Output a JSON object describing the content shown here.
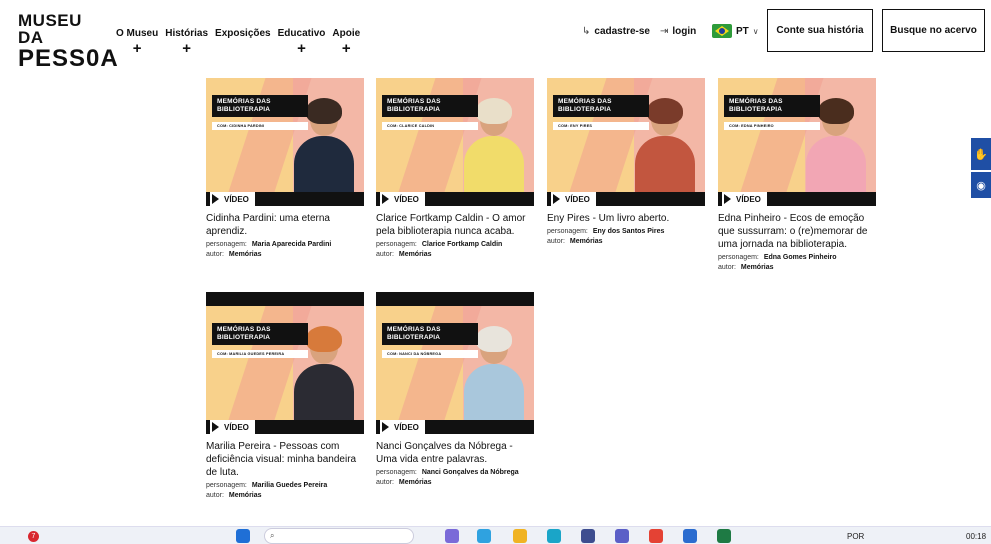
{
  "header": {
    "logo_line1": "MUSEU DA",
    "logo_line2": "PESS0A",
    "nav": [
      {
        "label": "O Museu",
        "plus": "+"
      },
      {
        "label": "Histórias",
        "plus": "+"
      },
      {
        "label": "Exposições",
        "plus": ""
      },
      {
        "label": "Educativo",
        "plus": "+"
      },
      {
        "label": "Apoie",
        "plus": "+"
      }
    ],
    "register_label": "cadastre-se",
    "login_label": "login",
    "language": "PT",
    "share_story_label": "Conte sua história",
    "search_collection_label": "Busque no acervo"
  },
  "cards": [
    {
      "tag_line1": "MEMÓRIAS DAS",
      "tag_line2": "BIBLIOTERAPIA",
      "tag_sub": "COM: CIDINHA PARDINI",
      "video_label": "VÍDEO",
      "title": "Cidinha Pardini: uma eterna aprendiz.",
      "persona_label": "personagem:",
      "persona": "Maria Aparecida Pardini",
      "author_label": "autor:",
      "author": "Memórias",
      "hair": "#3a2a22",
      "shirt": "#1f2a3d"
    },
    {
      "tag_line1": "MEMÓRIAS DAS",
      "tag_line2": "BIBLIOTERAPIA",
      "tag_sub": "COM: CLARICE CALDIN",
      "video_label": "VÍDEO",
      "title": "Clarice Fortkamp Caldin - O amor pela biblioterapia nunca acaba.",
      "persona_label": "personagem:",
      "persona": "Clarice Fortkamp Caldin",
      "author_label": "autor:",
      "author": "Memórias",
      "hair": "#e9dfc9",
      "shirt": "#f1dc6a"
    },
    {
      "tag_line1": "MEMÓRIAS DAS",
      "tag_line2": "BIBLIOTERAPIA",
      "tag_sub": "COM: ENY PIRES",
      "video_label": "VÍDEO",
      "title": "Eny Pires - Um livro aberto.",
      "persona_label": "personagem:",
      "persona": "Eny dos Santos Pires",
      "author_label": "autor:",
      "author": "Memórias",
      "hair": "#7a3b2a",
      "shirt": "#c2563f"
    },
    {
      "tag_line1": "MEMÓRIAS DAS",
      "tag_line2": "BIBLIOTERAPIA",
      "tag_sub": "COM: EDNA PINHEIRO",
      "video_label": "VÍDEO",
      "title": "Edna Pinheiro - Ecos de emoção que sussurram: o (re)memorar de uma jornada na biblioterapia.",
      "persona_label": "personagem:",
      "persona": "Edna Gomes Pinheiro",
      "author_label": "autor:",
      "author": "Memórias",
      "hair": "#4a2d1e",
      "shirt": "#f2a6b4"
    },
    {
      "tag_line1": "MEMÓRIAS DAS",
      "tag_line2": "BIBLIOTERAPIA",
      "tag_sub": "COM: MARILIA GUEDES PEREIRA",
      "video_label": "VÍDEO",
      "title": "Marilia Pereira - Pessoas com deficiência visual: minha bandeira de luta.",
      "persona_label": "personagem:",
      "persona": "Marilia Guedes Pereira",
      "author_label": "autor:",
      "author": "Memórias",
      "hair": "#d77a3b",
      "shirt": "#2b2b33"
    },
    {
      "tag_line1": "MEMÓRIAS DAS",
      "tag_line2": "BIBLIOTERAPIA",
      "tag_sub": "COM: NANCI DA NÓBREGA",
      "video_label": "VÍDEO",
      "title": "Nanci Gonçalves da Nóbrega - Uma vida entre palavras.",
      "persona_label": "personagem:",
      "persona": "Nanci Gonçalves da Nóbrega",
      "author_label": "autor:",
      "author": "Memórias",
      "hair": "#e8e4dc",
      "shirt": "#a9c7dc"
    }
  ],
  "taskbar": {
    "notification_count": "7",
    "search_icon": "search-icon",
    "language": "POR",
    "time": "00:18"
  },
  "colors": {
    "accent_blue": "#1f4fa5",
    "thumb_yellow": "#f8d18b",
    "thumb_pink": "#f3b7a6"
  }
}
